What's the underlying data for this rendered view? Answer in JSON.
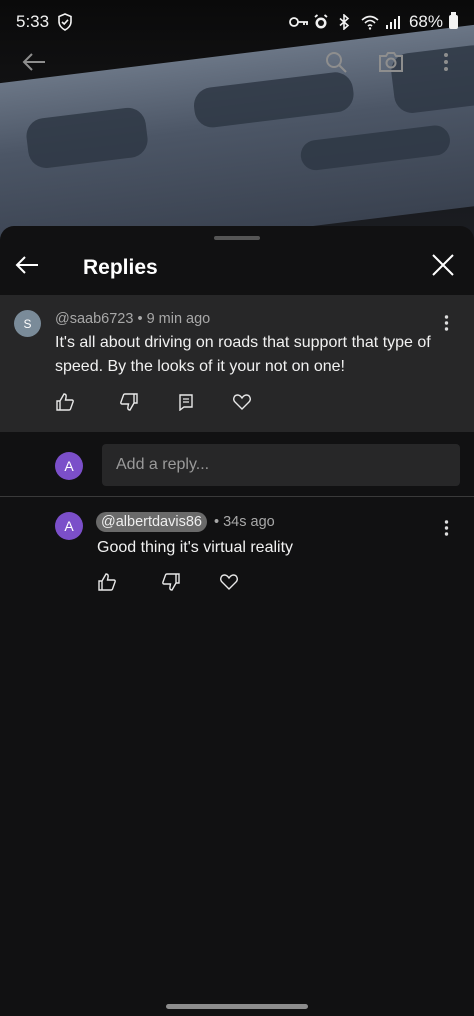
{
  "status_bar": {
    "time": "5:33",
    "battery": "68%"
  },
  "sheet": {
    "title": "Replies"
  },
  "parent_comment": {
    "avatar_letter": "S",
    "author": "@saab6723",
    "separator": "•",
    "time_ago": "9 min ago",
    "text": "It's all about driving on roads that support that type of speed. By the looks of it your not on one!"
  },
  "reply_input": {
    "avatar_letter": "A",
    "placeholder": "Add a reply..."
  },
  "replies": [
    {
      "avatar_letter": "A",
      "author": "@albertdavis86",
      "separator": "•",
      "time_ago": "34s ago",
      "text": "Good thing it's virtual reality"
    }
  ],
  "colors": {
    "sheet_bg": "#111112",
    "card_bg": "#272728",
    "avatar_purple": "#7b4fc9",
    "avatar_gray": "#7a8b99"
  }
}
